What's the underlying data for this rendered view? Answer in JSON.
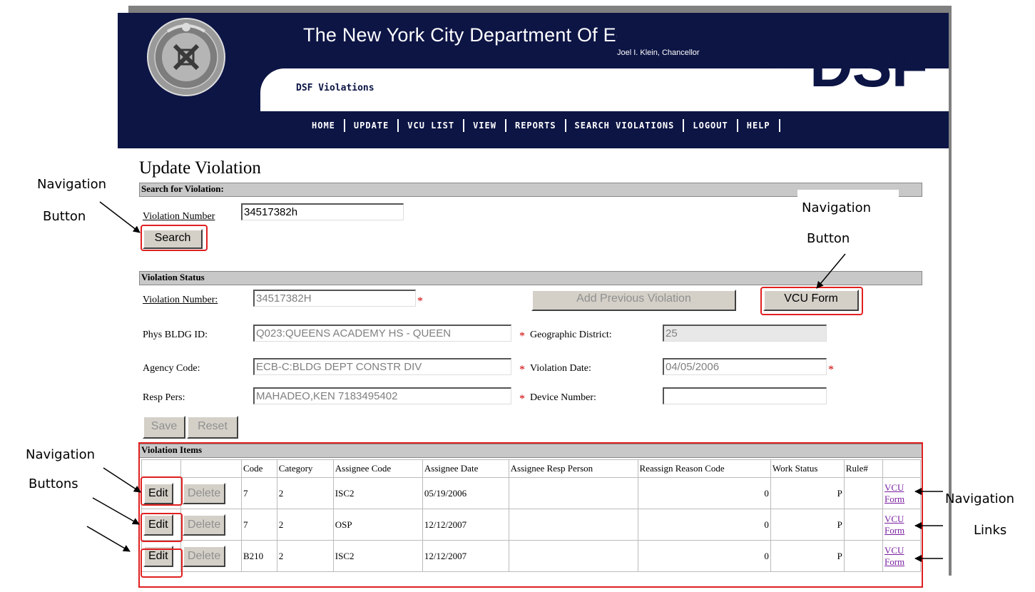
{
  "header": {
    "title": "The New York City Department Of Education",
    "subtitle": "Joel I. Klein, Chancellor",
    "app_name": "DSF Violations",
    "logo": "DSF"
  },
  "nav": [
    "HOME",
    "UPDATE",
    "VCU LIST",
    "VIEW",
    "REPORTS",
    "SEARCH VIOLATIONS",
    "LOGOUT",
    "HELP"
  ],
  "page": {
    "title": "Update Violation"
  },
  "search": {
    "section_title": "Search for Violation:",
    "label": "Violation Number",
    "value": "34517382h",
    "button": "Search"
  },
  "status": {
    "section_title": "Violation Status",
    "violation_number_label": "Violation Number:",
    "violation_number_value": "34517382H",
    "add_previous_button": "Add Previous Violation",
    "vcu_form_button": "VCU Form",
    "phys_bldg_label": "Phys BLDG ID:",
    "phys_bldg_value": "Q023:QUEENS ACADEMY HS - QUEEN",
    "geo_district_label": "Geographic District:",
    "geo_district_value": "25",
    "agency_code_label": "Agency Code:",
    "agency_code_value": "ECB-C:BLDG DEPT CONSTR DIV",
    "violation_date_label": "Violation Date:",
    "violation_date_value": "04/05/2006",
    "resp_pers_label": "Resp Pers:",
    "resp_pers_value": "MAHADEO,KEN 7183495402",
    "device_number_label": "Device Number:",
    "device_number_value": "",
    "save_button": "Save",
    "reset_button": "Reset",
    "required_mark": "*"
  },
  "items": {
    "section_title": "Violation Items",
    "columns": [
      "Code",
      "Category",
      "Assignee Code",
      "Assignee Date",
      "Assignee Resp Person",
      "Reassign Reason Code",
      "Work Status",
      "Rule#"
    ],
    "edit_label": "Edit",
    "delete_label": "Delete",
    "link_line1": "VCU",
    "link_line2": "Form",
    "rows": [
      {
        "code": "7",
        "category": "2",
        "assignee_code": "ISC2",
        "assignee_date": "05/19/2006",
        "resp_person": "",
        "reassign": "0",
        "work_status": "P",
        "rule": ""
      },
      {
        "code": "7",
        "category": "2",
        "assignee_code": "OSP",
        "assignee_date": "12/12/2007",
        "resp_person": "",
        "reassign": "0",
        "work_status": "P",
        "rule": ""
      },
      {
        "code": "B210",
        "category": "2",
        "assignee_code": "ISC2",
        "assignee_date": "12/12/2007",
        "resp_person": "",
        "reassign": "0",
        "work_status": "P",
        "rule": ""
      }
    ]
  },
  "annotations": {
    "nav_button_line1": "Navigation",
    "nav_button_line2": "Button",
    "nav_buttons_line2": "Buttons",
    "nav_links_line2": "Links"
  }
}
